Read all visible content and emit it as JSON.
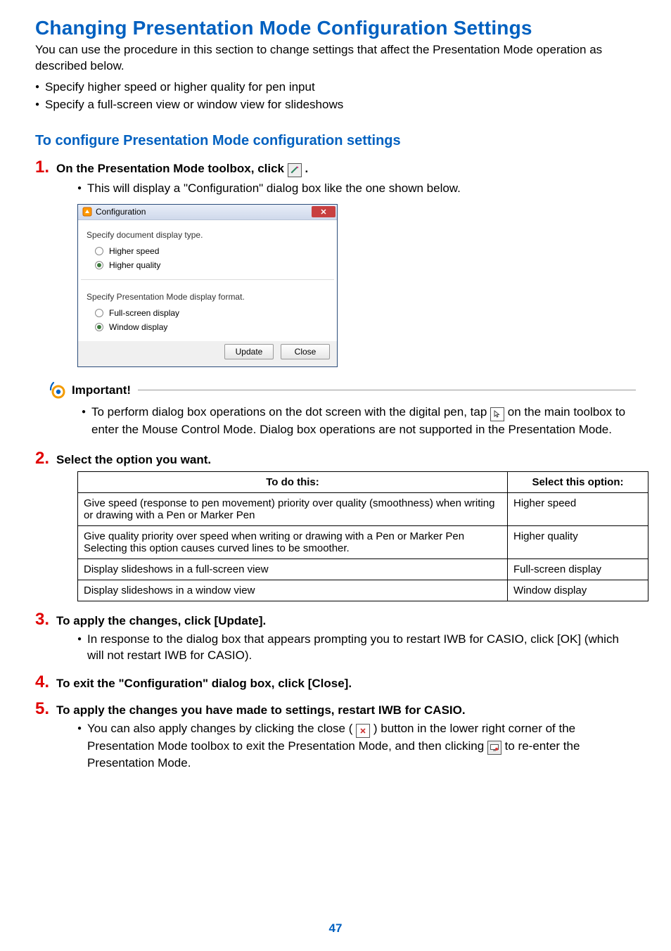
{
  "page": {
    "title": "Changing Presentation Mode Configuration Settings",
    "intro": "You can use the procedure in this section to change settings that affect the Presentation Mode operation as described below.",
    "bullets": [
      "Specify higher speed or higher quality for pen input",
      "Specify a full-screen view or window view for slideshows"
    ],
    "h2": "To configure Presentation Mode configuration settings"
  },
  "steps": {
    "s1": {
      "num": "1.",
      "text_a": "On the Presentation Mode toolbox, click ",
      "text_b": ".",
      "sub": "This will display a \"Configuration\" dialog box like the one shown below."
    },
    "s2": {
      "num": "2.",
      "text": "Select the option you want."
    },
    "s3": {
      "num": "3.",
      "text": "To apply the changes, click [Update].",
      "sub": "In response to the dialog box that appears prompting you to restart IWB for CASIO, click [OK] (which will not restart IWB for CASIO)."
    },
    "s4": {
      "num": "4.",
      "text": "To exit the \"Configuration\" dialog box, click [Close]."
    },
    "s5": {
      "num": "5.",
      "text": "To apply the changes you have made to settings, restart IWB for CASIO.",
      "sub_a": "You can also apply changes by clicking the close (",
      "sub_b": ") button in the lower right corner of the Presentation Mode toolbox to exit the Presentation Mode, and then clicking ",
      "sub_c": " to re-enter the Presentation Mode."
    }
  },
  "dialog": {
    "title": "Configuration",
    "group1": "Specify document display type.",
    "opt_hs": "Higher speed",
    "opt_hq": "Higher quality",
    "group2": "Specify Presentation Mode display format.",
    "opt_fs": "Full-screen display",
    "opt_wd": "Window display",
    "btn_update": "Update",
    "btn_close": "Close"
  },
  "important": {
    "label": "Important!",
    "body_a": "To perform dialog box operations on the dot screen with the digital pen, tap ",
    "body_b": " on the main toolbox to enter the Mouse Control Mode. Dialog box operations are not supported in the Presentation Mode."
  },
  "table": {
    "h1": "To do this:",
    "h2": "Select this option:",
    "rows": [
      {
        "a": "Give speed (response to pen movement) priority over quality (smoothness) when writing or drawing with a Pen or Marker Pen",
        "b": "Higher speed"
      },
      {
        "a": "Give quality priority over speed when writing or drawing with a Pen or Marker Pen\nSelecting this option causes curved lines to be smoother.",
        "b": "Higher quality"
      },
      {
        "a": "Display slideshows in a full-screen view",
        "b": "Full-screen display"
      },
      {
        "a": "Display slideshows in a window view",
        "b": "Window display"
      }
    ]
  },
  "page_number": "47"
}
